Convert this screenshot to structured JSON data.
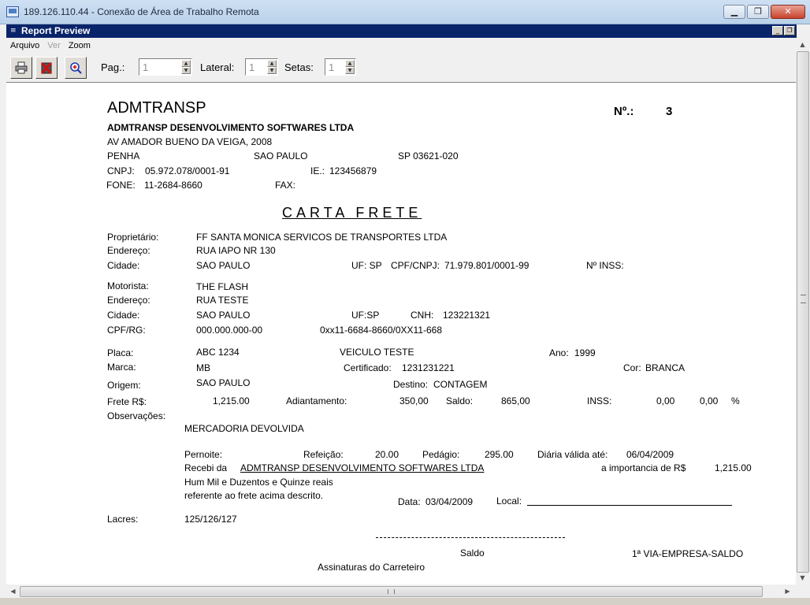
{
  "window": {
    "title": "189.126.110.44 - Conexão de Área de Trabalho Remota",
    "icon": "remote-desktop-icon",
    "controls": {
      "minimize": "▁",
      "restore": "❐",
      "close": "✕"
    }
  },
  "child_window": {
    "title": "Report Preview",
    "controls": {
      "minimize": "_",
      "restore": "❐"
    }
  },
  "menu": {
    "items": [
      {
        "label": "Arquivo",
        "enabled": true
      },
      {
        "label": "Ver",
        "enabled": false
      },
      {
        "label": "Zoom",
        "enabled": true
      }
    ]
  },
  "toolbar": {
    "print_icon": "printer-icon",
    "close_icon": "close-report-icon",
    "zoom_icon": "zoom-in-icon",
    "pag_label": "Pag.:",
    "pag_value": "1",
    "lateral_label": "Lateral:",
    "lateral_value": "1",
    "setas_label": "Setas:",
    "setas_value": "1"
  },
  "report": {
    "company_short": "ADMTRANSP",
    "company_name": "ADMTRANSP DESENVOLVIMENTO SOFTWARES LTDA",
    "address": "AV AMADOR BUENO DA VEIGA, 2008",
    "district": "PENHA",
    "city": "SAO PAULO",
    "state_zip": "SP 03621-020",
    "cnpj_label": "CNPJ:",
    "cnpj": "05.972.078/0001-91",
    "ie_label": "IE.:",
    "ie": "123456879",
    "fone_label": "FONE:",
    "fone": "11-2684-8660",
    "fax_label": "FAX:",
    "number_label": "Nº.:",
    "number": "3",
    "heading": "CARTA FRETE",
    "owner": {
      "label": "Proprietário:",
      "name": "FF SANTA MONICA SERVICOS DE TRANSPORTES LTDA",
      "address_label": "Endereço:",
      "address": "RUA IAPO NR 130",
      "city_label": "Cidade:",
      "city": "SAO PAULO",
      "uf_label": "UF: SP",
      "cpf_label": "CPF/CNPJ:",
      "cpf": "71.979.801/0001-99",
      "inss_label": "Nº INSS:"
    },
    "driver": {
      "label": "Motorista:",
      "name": "THE FLASH",
      "address_label": "Endereço:",
      "address": "RUA TESTE",
      "city_label": "Cidade:",
      "city": "SAO PAULO",
      "uf_label": "UF:SP",
      "cnh_label": "CNH:",
      "cnh": "123221321",
      "cpf_label": "CPF/RG:",
      "cpf": "000.000.000-00",
      "phones": "0xx11-6684-8660/0XX11-668"
    },
    "vehicle": {
      "plate_label": "Placa:",
      "plate": "ABC 1234",
      "model": "VEICULO TESTE",
      "year_label": "Ano:",
      "year": "1999",
      "brand_label": "Marca:",
      "brand": "MB",
      "cert_label": "Certificado:",
      "cert": "1231231221",
      "color_label": "Cor:",
      "color": "BRANCA"
    },
    "route": {
      "origin_label": "Origem:",
      "origin": "SAO PAULO",
      "dest_label": "Destino:",
      "dest": "CONTAGEM"
    },
    "values": {
      "frete_label": "Frete R$:",
      "frete": "1,215.00",
      "adiant_label": "Adiantamento:",
      "adiant": "350,00",
      "saldo_label": "Saldo:",
      "saldo": "865,00",
      "inss_label": "INSS:",
      "inss1": "0,00",
      "inss2": "0,00",
      "pct": "%"
    },
    "obs_label": "Observações:",
    "obs": "MERCADORIA  DEVOLVIDA",
    "pernoite_label": "Pernoite:",
    "refeicao_label": "Refeição:",
    "refeicao": "20.00",
    "pedagio_label": "Pedágio:",
    "pedagio": "295.00",
    "diaria_label": "Diária válida até:",
    "diaria": "06/04/2009",
    "recebi_label": "Recebi da",
    "recebi_company": "ADMTRANSP DESENVOLVIMENTO SOFTWARES LTDA",
    "importancia_label": "a importancia de R$",
    "importancia": "1,215.00",
    "extenso": "Hum Mil e Duzentos e Quinze reais",
    "referente": "referente ao frete acima descrito.",
    "data_label": "Data:",
    "data": "03/04/2009",
    "local_label": "Local:",
    "lacres_label": "Lacres:",
    "lacres": "125/126/127",
    "saldo_sign": "Saldo",
    "via": "1ª VIA-EMPRESA-SALDO",
    "assinaturas": "Assinaturas do Carreteiro"
  }
}
